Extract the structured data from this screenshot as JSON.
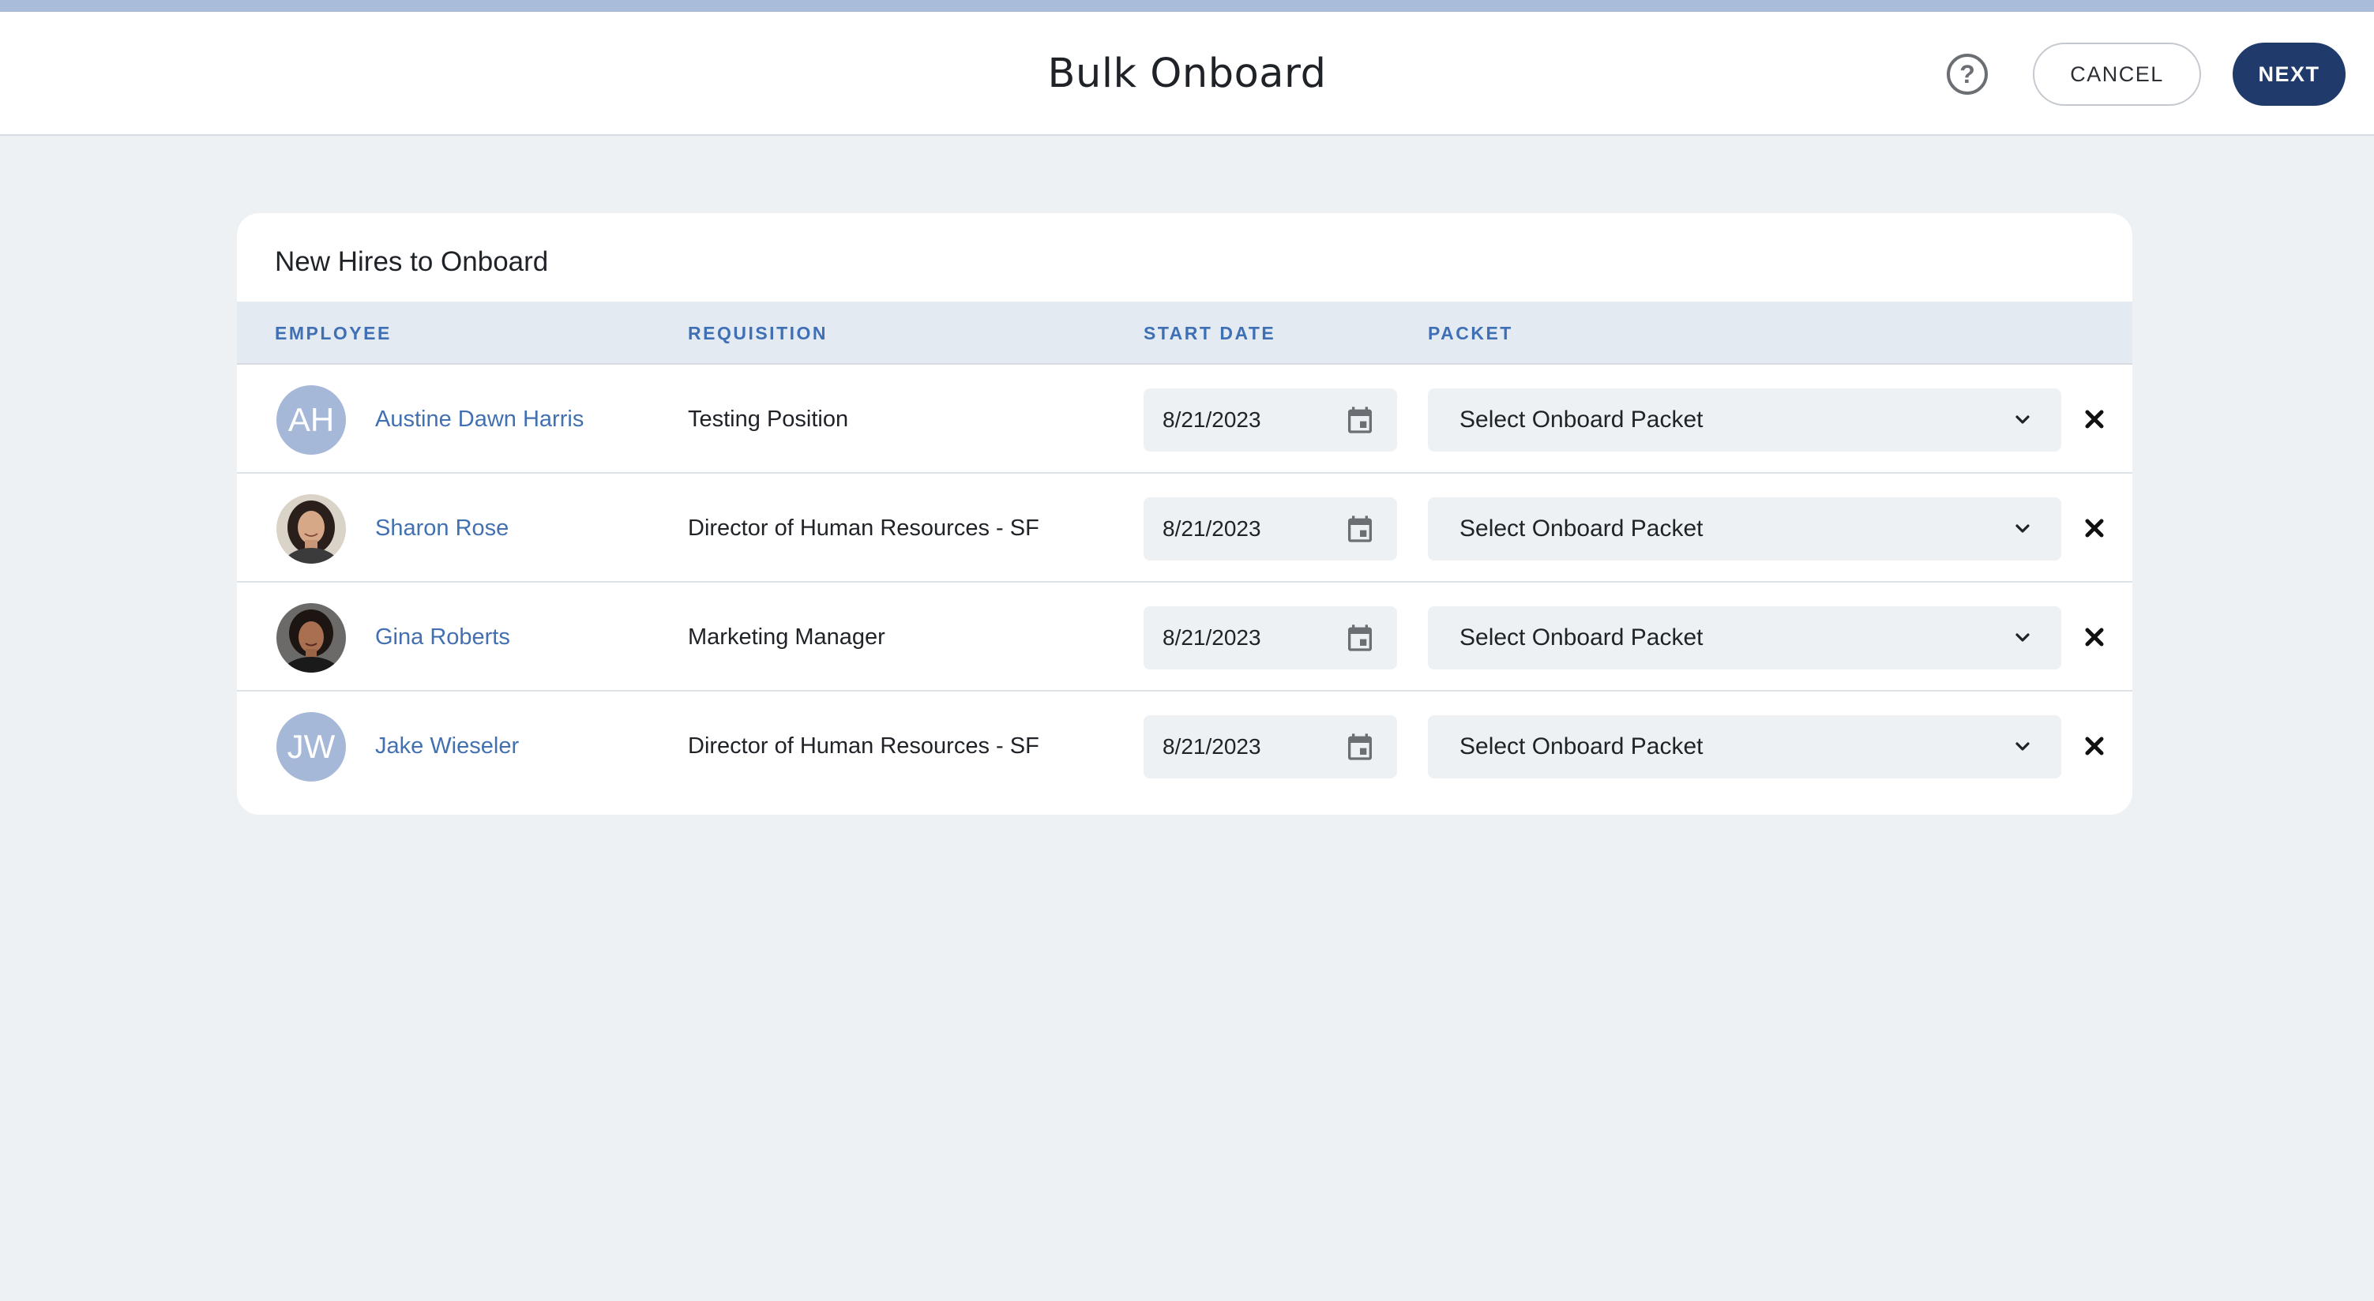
{
  "header": {
    "title": "Bulk Onboard",
    "help_icon": "help-circle-icon",
    "help_glyph": "?",
    "cancel_label": "CANCEL",
    "next_label": "NEXT",
    "accent_color": "#1f3a6b"
  },
  "card": {
    "title": "New Hires to Onboard",
    "columns": {
      "employee": "EMPLOYEE",
      "requisition": "REQUISITION",
      "start_date": "START DATE",
      "packet": "PACKET"
    },
    "rows": [
      {
        "initials": "AH",
        "name": "Austine Dawn Harris",
        "requisition": "Testing Position",
        "start_date": "8/21/2023",
        "packet": "Select Onboard Packet",
        "avatar": "initials"
      },
      {
        "initials": "",
        "name": "Sharon Rose",
        "requisition": "Director of Human Resources - SF",
        "start_date": "8/21/2023",
        "packet": "Select Onboard Packet",
        "avatar": "photo"
      },
      {
        "initials": "",
        "name": "Gina Roberts",
        "requisition": "Marketing Manager",
        "start_date": "8/21/2023",
        "packet": "Select Onboard Packet",
        "avatar": "photo"
      },
      {
        "initials": "JW",
        "name": "Jake Wieseler",
        "requisition": "Director of Human Resources - SF",
        "start_date": "8/21/2023",
        "packet": "Select Onboard Packet",
        "avatar": "initials"
      }
    ]
  },
  "icons": {
    "calendar": "calendar-icon",
    "dropdown": "chevron-down-icon",
    "remove": "close-icon"
  },
  "colors": {
    "link": "#4270b0",
    "column_header": "#3f6fb5",
    "avatar_initials_bg": "#a6b8d8",
    "page_bg": "#edf1f4"
  }
}
